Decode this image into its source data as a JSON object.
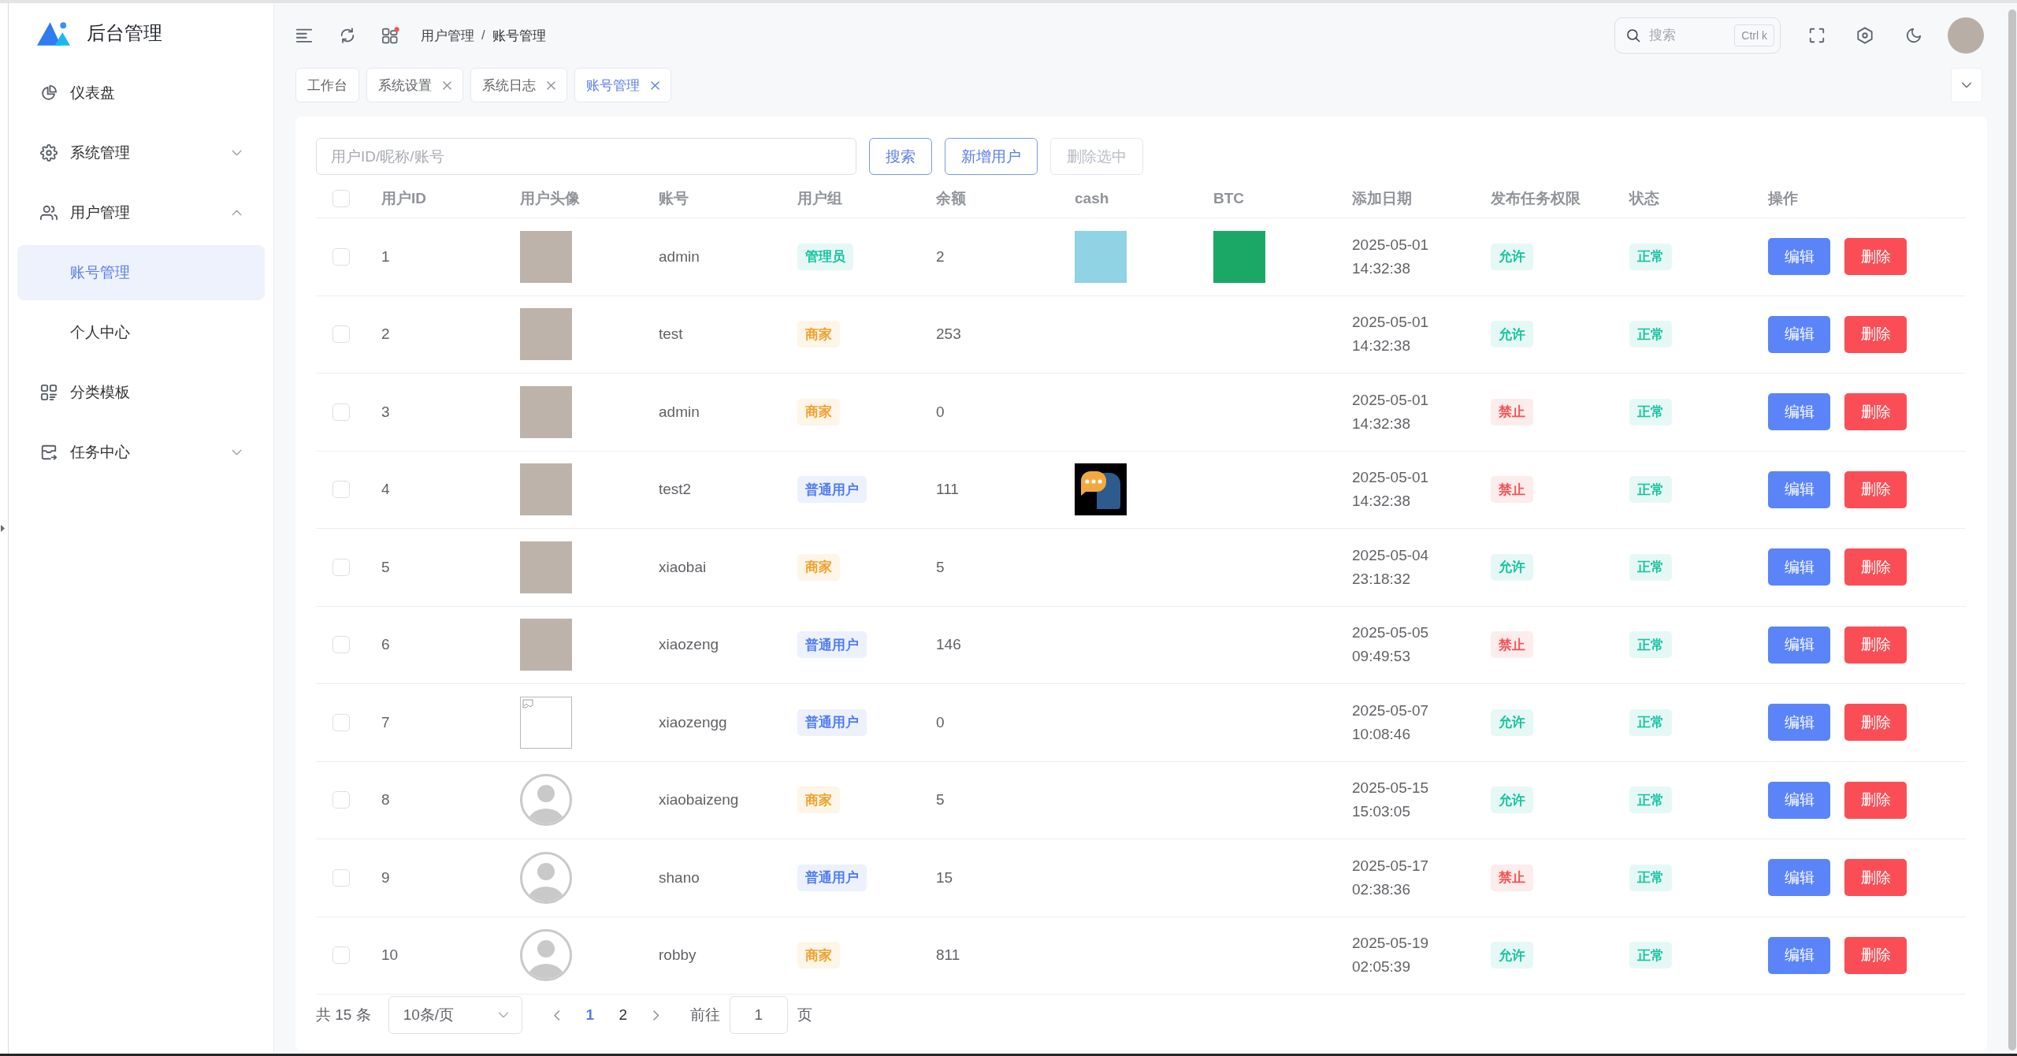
{
  "sidebar": {
    "logo": "后台管理",
    "items": [
      {
        "label": "仪表盘",
        "kind": "link",
        "selected": false
      },
      {
        "label": "系统管理",
        "kind": "group",
        "expanded": false,
        "selected": false
      },
      {
        "label": "用户管理",
        "kind": "group",
        "expanded": true,
        "selected": false,
        "children": [
          {
            "label": "账号管理",
            "selected": true
          },
          {
            "label": "个人中心",
            "selected": false
          }
        ]
      },
      {
        "label": "分类模板",
        "kind": "link",
        "selected": false
      },
      {
        "label": "任务中心",
        "kind": "group",
        "expanded": false,
        "selected": false
      }
    ]
  },
  "header": {
    "breadcrumb": {
      "items": [
        "用户管理",
        "账号管理"
      ],
      "separator": "/"
    },
    "search": {
      "placeholder": "搜索",
      "shortcut": "Ctrl k"
    }
  },
  "tabs": [
    {
      "label": "工作台",
      "closable": false,
      "selected": false
    },
    {
      "label": "系统设置",
      "closable": true,
      "selected": false
    },
    {
      "label": "系统日志",
      "closable": true,
      "selected": false
    },
    {
      "label": "账号管理",
      "closable": true,
      "selected": true
    }
  ],
  "toolbar": {
    "search": {
      "placeholder": "用户ID/昵称/账号"
    },
    "buttons": [
      {
        "label": "搜索",
        "disabled": false
      },
      {
        "label": "新增用户",
        "disabled": false
      },
      {
        "label": "删除选中",
        "disabled": true
      }
    ]
  },
  "table": {
    "all_checked": false,
    "columns": [
      "用户ID",
      "用户头像",
      "账号",
      "用户组",
      "余额",
      "cash",
      "BTC",
      "添加日期",
      "发布任务权限",
      "状态",
      "操作"
    ],
    "rows": [
      {
        "checked": false,
        "id": "1",
        "avatar": {
          "kind": "photo"
        },
        "account": "admin",
        "group": {
          "text": "管理员",
          "color": "#17c3a0"
        },
        "balance": "2",
        "cash": {
          "kind": "picture"
        },
        "btc": {
          "kind": "picture"
        },
        "date": "2025-05-01 14:32:38",
        "permission": {
          "text": "允许",
          "color": "#17c3a0"
        },
        "status": {
          "text": "正常",
          "color": "#17c3a0"
        },
        "actions": [
          {
            "label": "编辑",
            "kind": "edit"
          },
          {
            "label": "删除",
            "kind": "delete"
          }
        ]
      },
      {
        "checked": false,
        "id": "2",
        "avatar": {
          "kind": "photo"
        },
        "account": "test",
        "group": {
          "text": "商家",
          "color": "#f0a12b"
        },
        "balance": "253",
        "date": "2025-05-01 14:32:38",
        "permission": {
          "text": "允许",
          "color": "#17c3a0"
        },
        "status": {
          "text": "正常",
          "color": "#17c3a0"
        },
        "actions": [
          {
            "label": "编辑",
            "kind": "edit"
          },
          {
            "label": "删除",
            "kind": "delete"
          }
        ]
      },
      {
        "checked": false,
        "id": "3",
        "avatar": {
          "kind": "photo"
        },
        "account": "admin",
        "group": {
          "text": "商家",
          "color": "#f0a12b"
        },
        "balance": "0",
        "date": "2025-05-01 14:32:38",
        "permission": {
          "text": "禁止",
          "color": "#f05656"
        },
        "status": {
          "text": "正常",
          "color": "#17c3a0"
        },
        "actions": [
          {
            "label": "编辑",
            "kind": "edit"
          },
          {
            "label": "删除",
            "kind": "delete"
          }
        ]
      },
      {
        "checked": false,
        "id": "4",
        "avatar": {
          "kind": "photo"
        },
        "account": "test2",
        "group": {
          "text": "普通用户",
          "color": "#4f7cf0"
        },
        "balance": "111",
        "cash": {
          "kind": "chat-bubbles"
        },
        "date": "2025-05-01 14:32:38",
        "permission": {
          "text": "禁止",
          "color": "#f05656"
        },
        "status": {
          "text": "正常",
          "color": "#17c3a0"
        },
        "actions": [
          {
            "label": "编辑",
            "kind": "edit"
          },
          {
            "label": "删除",
            "kind": "delete"
          }
        ]
      },
      {
        "checked": false,
        "id": "5",
        "avatar": {
          "kind": "photo"
        },
        "account": "xiaobai",
        "group": {
          "text": "商家",
          "color": "#f0a12b"
        },
        "balance": "5",
        "date": "2025-05-04 23:18:32",
        "permission": {
          "text": "允许",
          "color": "#17c3a0"
        },
        "status": {
          "text": "正常",
          "color": "#17c3a0"
        },
        "actions": [
          {
            "label": "编辑",
            "kind": "edit"
          },
          {
            "label": "删除",
            "kind": "delete"
          }
        ]
      },
      {
        "checked": false,
        "id": "6",
        "avatar": {
          "kind": "photo"
        },
        "account": "xiaozeng",
        "group": {
          "text": "普通用户",
          "color": "#4f7cf0"
        },
        "balance": "146",
        "date": "2025-05-05 09:49:53",
        "permission": {
          "text": "禁止",
          "color": "#f05656"
        },
        "status": {
          "text": "正常",
          "color": "#17c3a0"
        },
        "actions": [
          {
            "label": "编辑",
            "kind": "edit"
          },
          {
            "label": "删除",
            "kind": "delete"
          }
        ]
      },
      {
        "checked": false,
        "id": "7",
        "avatar": {
          "kind": "broken"
        },
        "account": "xiaozengg",
        "group": {
          "text": "普通用户",
          "color": "#4f7cf0"
        },
        "balance": "0",
        "date": "2025-05-07 10:08:46",
        "permission": {
          "text": "允许",
          "color": "#17c3a0"
        },
        "status": {
          "text": "正常",
          "color": "#17c3a0"
        },
        "actions": [
          {
            "label": "编辑",
            "kind": "edit"
          },
          {
            "label": "删除",
            "kind": "delete"
          }
        ]
      },
      {
        "checked": false,
        "id": "8",
        "avatar": {
          "kind": "default"
        },
        "account": "xiaobaizeng",
        "group": {
          "text": "商家",
          "color": "#f0a12b"
        },
        "balance": "5",
        "date": "2025-05-15 15:03:05",
        "permission": {
          "text": "允许",
          "color": "#17c3a0"
        },
        "status": {
          "text": "正常",
          "color": "#17c3a0"
        },
        "actions": [
          {
            "label": "编辑",
            "kind": "edit"
          },
          {
            "label": "删除",
            "kind": "delete"
          }
        ]
      },
      {
        "checked": false,
        "id": "9",
        "avatar": {
          "kind": "default"
        },
        "account": "shano",
        "group": {
          "text": "普通用户",
          "color": "#4f7cf0"
        },
        "balance": "15",
        "date": "2025-05-17 02:38:36",
        "permission": {
          "text": "禁止",
          "color": "#f05656"
        },
        "status": {
          "text": "正常",
          "color": "#17c3a0"
        },
        "actions": [
          {
            "label": "编辑",
            "kind": "edit"
          },
          {
            "label": "删除",
            "kind": "delete"
          }
        ]
      },
      {
        "checked": false,
        "id": "10",
        "avatar": {
          "kind": "default"
        },
        "account": "robby",
        "group": {
          "text": "商家",
          "color": "#f0a12b"
        },
        "balance": "811",
        "date": "2025-05-19 02:05:39",
        "permission": {
          "text": "允许",
          "color": "#17c3a0"
        },
        "status": {
          "text": "正常",
          "color": "#17c3a0"
        },
        "actions": [
          {
            "label": "编辑",
            "kind": "edit"
          },
          {
            "label": "删除",
            "kind": "delete"
          }
        ]
      }
    ]
  },
  "pagination": {
    "total": "共 15 条",
    "page_size": "10条/页",
    "pages": [
      {
        "label": "1",
        "selected": true
      },
      {
        "label": "2",
        "selected": false
      }
    ],
    "goto": {
      "label": "前往",
      "value": "1",
      "suffix": "页"
    }
  }
}
